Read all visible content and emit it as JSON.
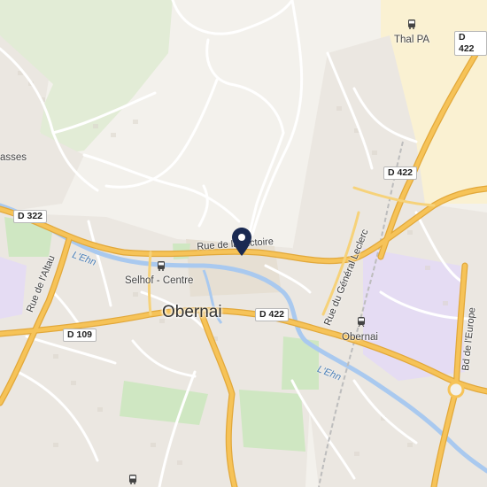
{
  "map": {
    "places": {
      "town": "Obernai",
      "thal_pa": "Thal PA",
      "selhof": "Selhof - Centre",
      "station": "Obernai",
      "edge_label": "asses"
    },
    "roads": {
      "d322": "D 322",
      "d109": "D 109",
      "d422_center": "D 422",
      "d422_right": "D 422",
      "d422_top": "D 422"
    },
    "streets": {
      "victoire": "Rue de la Victoire",
      "altau": "Rue de l'Altau",
      "leclerc": "Rue du Général Leclerc",
      "europe": "Bd de l'Europe"
    },
    "water": {
      "ehn_west": "L'Ehn",
      "ehn_east": "L'Ehn"
    },
    "colors": {
      "road_major": "#f6c358",
      "road_major_casing": "#e2a83a",
      "water": "#a9c9ef",
      "park": "#cfe7c2",
      "industrial": "#e5dcf3",
      "commercial": "#faf1d2",
      "pin": "#1a2a52"
    },
    "icons": [
      "bus-icon",
      "map-pin-icon"
    ]
  }
}
